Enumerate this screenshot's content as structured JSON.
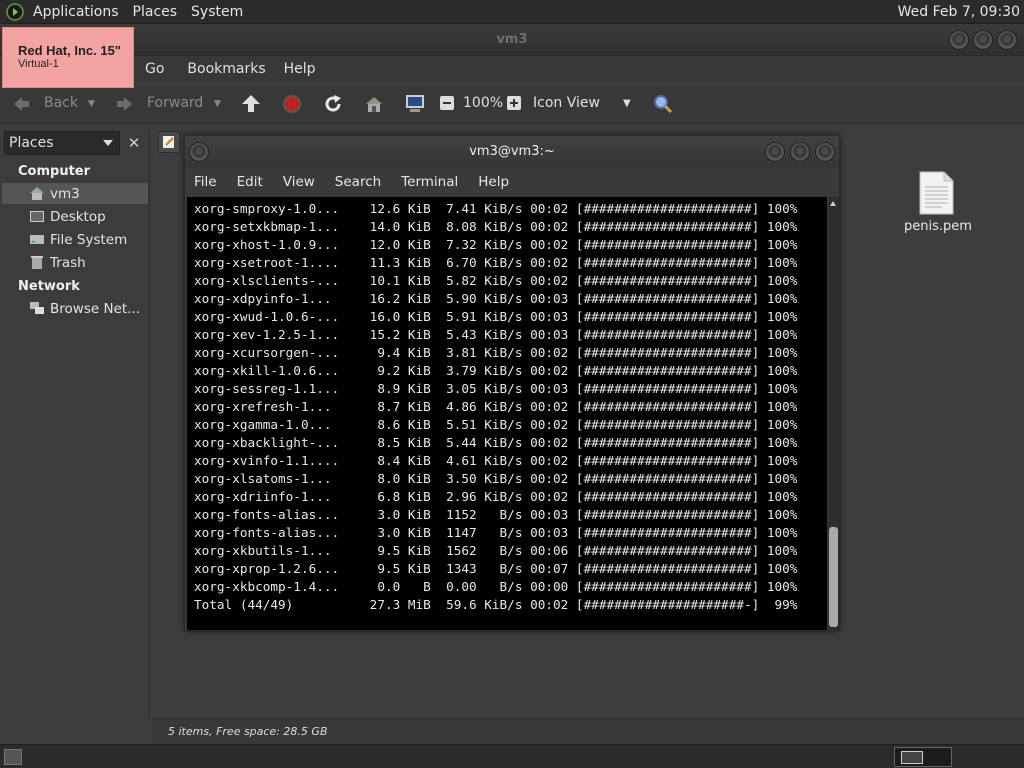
{
  "top_panel": {
    "menus": [
      "Applications",
      "Places",
      "System"
    ],
    "clock": "Wed Feb  7, 09:30"
  },
  "nautilus": {
    "title": "vm3",
    "menubar": [
      "Go",
      "Bookmarks",
      "Help"
    ],
    "toolbar": {
      "back": "Back",
      "forward": "Forward",
      "zoom": "100%",
      "view_mode": "Icon View"
    },
    "sidebar": {
      "header": "Places",
      "sections": [
        {
          "title": "Computer",
          "items": [
            "vm3",
            "Desktop",
            "File System",
            "Trash"
          ]
        },
        {
          "title": "Network",
          "items": [
            "Browse Net..."
          ]
        }
      ]
    },
    "file": "penis.pem",
    "status": "5 items, Free space: 28.5 GB"
  },
  "tooltip": {
    "line1": "Red Hat, Inc. 15\"",
    "line2": "Virtual-1"
  },
  "terminal": {
    "title": "vm3@vm3:~",
    "menubar": [
      "File",
      "Edit",
      "View",
      "Search",
      "Terminal",
      "Help"
    ],
    "lines": [
      "xorg-smproxy-1.0...    12.6 KiB  7.41 KiB/s 00:02 [######################] 100%",
      "xorg-setxkbmap-1...    14.0 KiB  8.08 KiB/s 00:02 [######################] 100%",
      "xorg-xhost-1.0.9...    12.0 KiB  7.32 KiB/s 00:02 [######################] 100%",
      "xorg-xsetroot-1....    11.3 KiB  6.70 KiB/s 00:02 [######################] 100%",
      "xorg-xlsclients-...    10.1 KiB  5.82 KiB/s 00:02 [######################] 100%",
      "xorg-xdpyinfo-1...     16.2 KiB  5.90 KiB/s 00:03 [######################] 100%",
      "xorg-xwud-1.0.6-...    16.0 KiB  5.91 KiB/s 00:03 [######################] 100%",
      "xorg-xev-1.2.5-1...    15.2 KiB  5.43 KiB/s 00:03 [######################] 100%",
      "xorg-xcursorgen-...     9.4 KiB  3.81 KiB/s 00:02 [######################] 100%",
      "xorg-xkill-1.0.6...     9.2 KiB  3.79 KiB/s 00:02 [######################] 100%",
      "xorg-sessreg-1.1...     8.9 KiB  3.05 KiB/s 00:03 [######################] 100%",
      "xorg-xrefresh-1...      8.7 KiB  4.86 KiB/s 00:02 [######################] 100%",
      "xorg-xgamma-1.0...      8.6 KiB  5.51 KiB/s 00:02 [######################] 100%",
      "xorg-xbacklight-...     8.5 KiB  5.44 KiB/s 00:02 [######################] 100%",
      "xorg-xvinfo-1.1....     8.4 KiB  4.61 KiB/s 00:02 [######################] 100%",
      "xorg-xlsatoms-1...      8.0 KiB  3.50 KiB/s 00:02 [######################] 100%",
      "xorg-xdriinfo-1...      6.8 KiB  2.96 KiB/s 00:02 [######################] 100%",
      "xorg-fonts-alias...     3.0 KiB  1152   B/s 00:03 [######################] 100%",
      "xorg-fonts-alias...     3.0 KiB  1147   B/s 00:03 [######################] 100%",
      "xorg-xkbutils-1...      9.5 KiB  1562   B/s 00:06 [######################] 100%",
      "xorg-xprop-1.2.6...     9.5 KiB  1343   B/s 00:07 [######################] 100%",
      "xorg-xkbcomp-1.4...     0.0   B  0.00   B/s 00:00 [######################] 100%",
      "Total (44/49)          27.3 MiB  59.6 KiB/s 00:02 [#####################-]  99%"
    ]
  },
  "colors": {
    "tooltip_bg": "#f4a3a3",
    "terminal_bg": "#000000",
    "panel_bg": "#2b2b2b"
  }
}
